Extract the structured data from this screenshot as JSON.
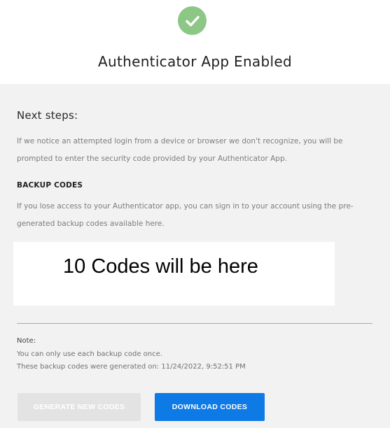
{
  "header": {
    "title": "Authenticator App Enabled",
    "icon": "check-circle-icon",
    "icon_color": "#8cc785"
  },
  "next_steps": {
    "heading": "Next steps:",
    "body": "If we notice an attempted login from a device or browser we don't recognize, you will be prompted to enter the security code provided by your Authenticator App."
  },
  "backup_codes": {
    "heading": "BACKUP CODES",
    "body": "If you lose access to your Authenticator app, you can sign in to your account using the pre-generated backup codes available here.",
    "placeholder": "10 Codes will be here"
  },
  "note": {
    "label": "Note:",
    "line1": "You can only use each backup code once.",
    "line2": "These backup codes were generated on: 11/24/2022, 9:52:51 PM"
  },
  "buttons": {
    "generate_label": "GENERATE NEW CODES",
    "generate_enabled": false,
    "download_label": "DOWNLOAD CODES",
    "download_color": "#0d7ae5"
  }
}
